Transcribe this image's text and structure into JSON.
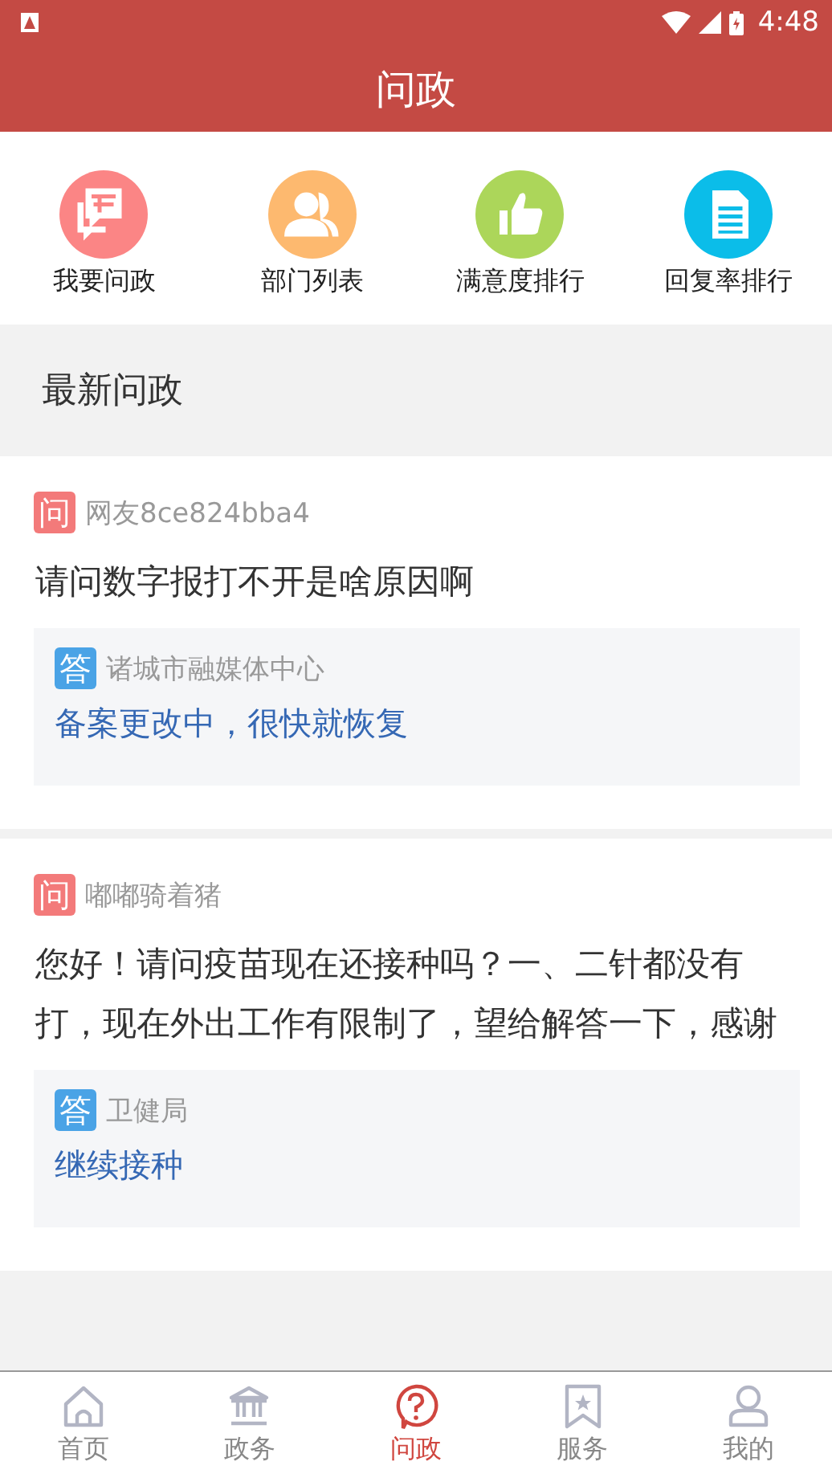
{
  "status_bar": {
    "time": "4:48"
  },
  "header": {
    "title": "问政"
  },
  "quick_menu": [
    {
      "label": "我要问政",
      "kind": "ask",
      "color": "#fb8585"
    },
    {
      "label": "部门列表",
      "kind": "people",
      "color": "#fdb96f"
    },
    {
      "label": "满意度排行",
      "kind": "thumb",
      "color": "#acd65a"
    },
    {
      "label": "回复率排行",
      "kind": "doc",
      "color": "#0bbde9"
    }
  ],
  "section": {
    "title": "最新问政"
  },
  "questions": [
    {
      "badge": "问",
      "user": "网友8ce824bba4",
      "question": "请问数字报打不开是啥原因啊",
      "answer_badge": "答",
      "department": "诸城市融媒体中心",
      "answer": "备案更改中，很快就恢复"
    },
    {
      "badge": "问",
      "user": "嘟嘟骑着猪",
      "question": "您好！请问疫苗现在还接种吗？一、二针都没有打，现在外出工作有限制了，望给解答一下，感谢",
      "answer_badge": "答",
      "department": "卫健局",
      "answer": "继续接种"
    }
  ],
  "bottom_nav": [
    {
      "label": "首页",
      "kind": "home",
      "selected": false
    },
    {
      "label": "政务",
      "kind": "bank",
      "selected": false
    },
    {
      "label": "问政",
      "kind": "question",
      "selected": true
    },
    {
      "label": "服务",
      "kind": "bookmark",
      "selected": false
    },
    {
      "label": "我的",
      "kind": "user",
      "selected": false
    }
  ]
}
